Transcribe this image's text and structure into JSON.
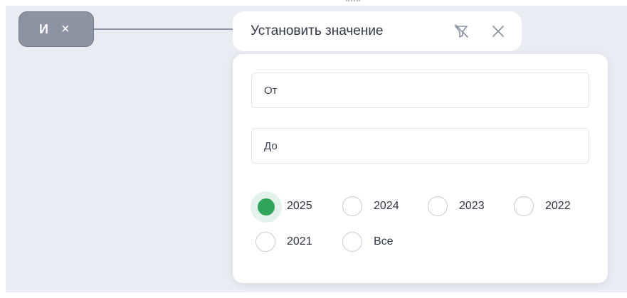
{
  "operator_chip": {
    "label": "И",
    "close_glyph": "×",
    "close_icon": "close-icon"
  },
  "filter": {
    "title": "Установить значение",
    "clear_filter_icon": "filter-off-icon",
    "close_icon": "close-icon",
    "from": {
      "value": "",
      "placeholder": "От"
    },
    "to": {
      "value": "",
      "placeholder": "До"
    },
    "options": [
      {
        "label": "2025",
        "checked": true
      },
      {
        "label": "2024",
        "checked": false
      },
      {
        "label": "2023",
        "checked": false
      },
      {
        "label": "2022",
        "checked": false
      },
      {
        "label": "2021",
        "checked": false
      },
      {
        "label": "Все",
        "checked": false
      }
    ],
    "accent": "#30a559"
  }
}
